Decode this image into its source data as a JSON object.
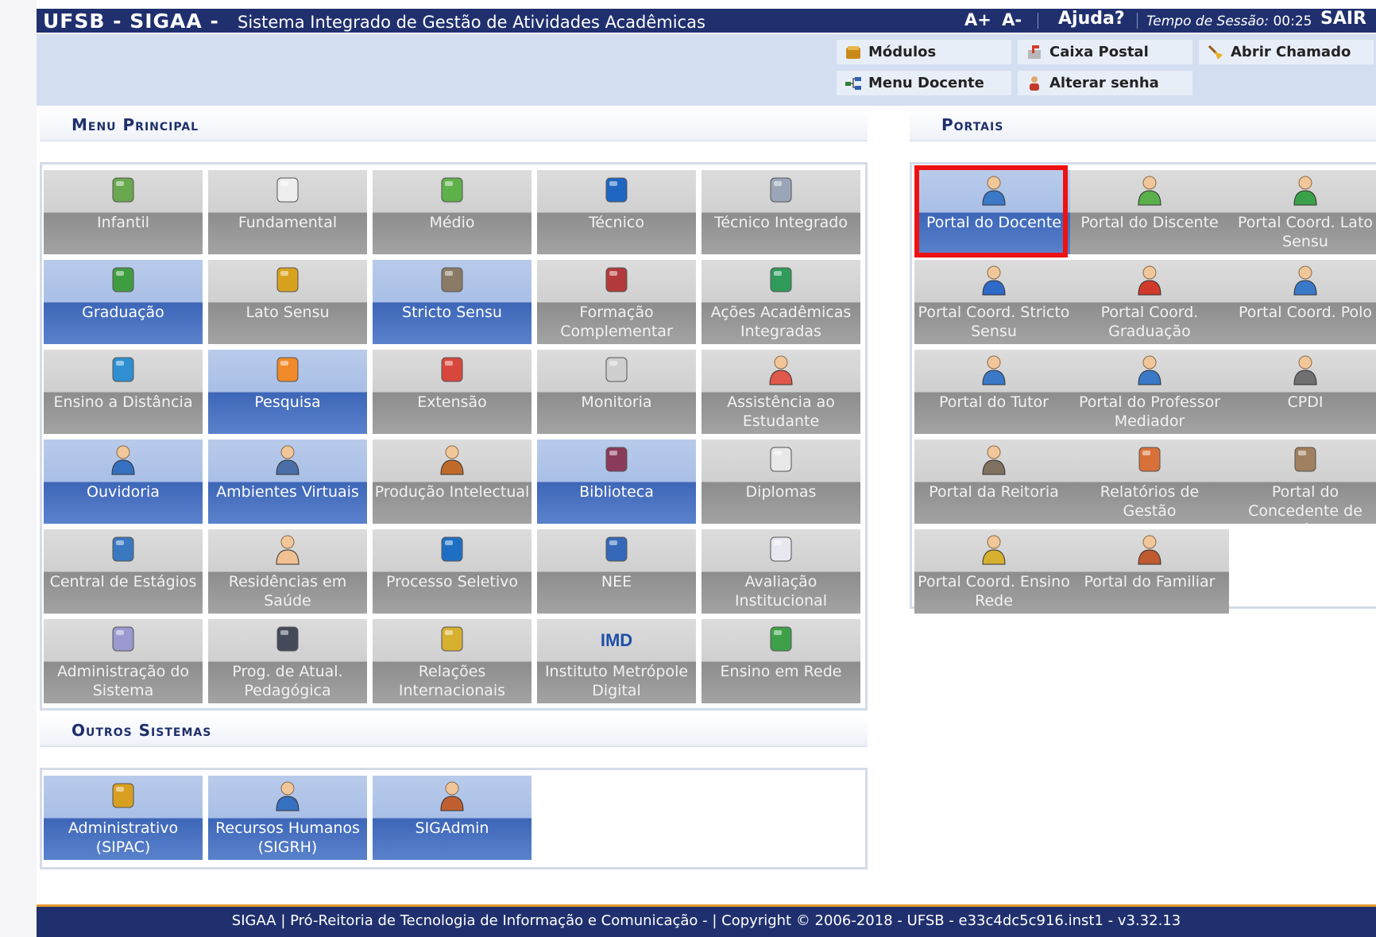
{
  "topbar": {
    "brand": "UFSB - SIGAA -",
    "system_name": "Sistema Integrado de Gestão de Atividades Acadêmicas",
    "font_increase": "A+",
    "font_decrease": "A-",
    "help": "Ajuda?",
    "session_label": "Tempo de Sessão:",
    "session_time": "00:25",
    "logout": "SAIR"
  },
  "quick_links": {
    "modules": "Módulos",
    "mailbox": "Caixa Postal",
    "open_ticket": "Abrir Chamado",
    "teacher_menu": "Menu Docente",
    "change_password": "Alterar senha"
  },
  "main_menu": {
    "title": "Menu Principal",
    "items": [
      {
        "label": "Infantil",
        "icon": "pencil-cup-icon",
        "active": false
      },
      {
        "label": "Fundamental",
        "icon": "notepad-icon",
        "active": false
      },
      {
        "label": "Médio",
        "icon": "pencil-icon",
        "active": false
      },
      {
        "label": "Técnico",
        "icon": "blue-book-icon",
        "active": false
      },
      {
        "label": "Técnico Integrado",
        "icon": "drafting-icon",
        "active": false
      },
      {
        "label": "Graduação",
        "icon": "books-stack-icon",
        "active": true
      },
      {
        "label": "Lato Sensu",
        "icon": "folder-icon",
        "active": false
      },
      {
        "label": "Stricto Sensu",
        "icon": "briefcase-icon",
        "active": true
      },
      {
        "label": "Formação Complementar",
        "icon": "red-book-icon",
        "active": false
      },
      {
        "label": "Ações Acadêmicas Integradas",
        "icon": "puzzle-icon",
        "active": false
      },
      {
        "label": "Ensino a Distância",
        "icon": "globe-icon",
        "active": false
      },
      {
        "label": "Pesquisa",
        "icon": "flask-icon",
        "active": true
      },
      {
        "label": "Extensão",
        "icon": "house-icon",
        "active": false
      },
      {
        "label": "Monitoria",
        "icon": "presentation-board-icon",
        "active": false
      },
      {
        "label": "Assistência ao Estudante",
        "icon": "student-support-icon",
        "active": false
      },
      {
        "label": "Ouvidoria",
        "icon": "headset-user-icon",
        "active": true
      },
      {
        "label": "Ambientes Virtuais",
        "icon": "user-group-icon",
        "active": true
      },
      {
        "label": "Produção Intelectual",
        "icon": "user-check-icon",
        "active": false
      },
      {
        "label": "Biblioteca",
        "icon": "open-book-icon",
        "active": true
      },
      {
        "label": "Diplomas",
        "icon": "certificate-icon",
        "active": false
      },
      {
        "label": "Central de Estágios",
        "icon": "address-book-icon",
        "active": false
      },
      {
        "label": "Residências em Saúde",
        "icon": "doctor-icon",
        "active": false
      },
      {
        "label": "Processo Seletivo",
        "icon": "spiral-icon",
        "active": false
      },
      {
        "label": "NEE",
        "icon": "accessibility-icon",
        "active": false
      },
      {
        "label": "Avaliação Institucional",
        "icon": "checklist-icon",
        "active": false
      },
      {
        "label": "Administração do Sistema",
        "icon": "gear-icon",
        "active": false
      },
      {
        "label": "Prog. de Atual. Pedagógica",
        "icon": "monitor-icon",
        "active": false
      },
      {
        "label": "Relações Internacionais",
        "icon": "world-map-icon",
        "active": false
      },
      {
        "label": "Instituto Metrópole Digital",
        "icon": "imd-logo-icon",
        "active": false
      },
      {
        "label": "Ensino em Rede",
        "icon": "network-map-icon",
        "active": false
      }
    ]
  },
  "other_systems": {
    "title": "Outros Sistemas",
    "items": [
      {
        "label": "Administrativo (SIPAC)",
        "icon": "admin-icon",
        "active": true
      },
      {
        "label": "Recursos Humanos (SIGRH)",
        "icon": "hr-person-icon",
        "active": true
      },
      {
        "label": "SIGAdmin",
        "icon": "admin-user-icon",
        "active": true
      }
    ]
  },
  "portals": {
    "title": "Portais",
    "items": [
      {
        "label": "Portal do Docente",
        "icon": "teacher-icon",
        "active": true
      },
      {
        "label": "Portal do Discente",
        "icon": "student-icon",
        "active": false
      },
      {
        "label": "Portal Coord. Lato Sensu",
        "icon": "coordinator-green-icon",
        "active": false
      },
      {
        "label": "Portal Coord. Stricto Sensu",
        "icon": "coordinator-blue-icon",
        "active": false
      },
      {
        "label": "Portal Coord. Graduação",
        "icon": "coordinator-red-icon",
        "active": false
      },
      {
        "label": "Portal Coord. Polo",
        "icon": "polo-coordinator-icon",
        "active": false
      },
      {
        "label": "Portal do Tutor",
        "icon": "tutor-icon",
        "active": false
      },
      {
        "label": "Portal do Professor Mediador",
        "icon": "mediator-icon",
        "active": false
      },
      {
        "label": "CPDI",
        "icon": "cpdi-user-icon",
        "active": false
      },
      {
        "label": "Portal da Reitoria",
        "icon": "rector-icon",
        "active": false
      },
      {
        "label": "Relatórios de Gestão",
        "icon": "reports-icon",
        "active": false
      },
      {
        "label": "Portal do Concedente de Estágio",
        "icon": "id-card-icon",
        "active": false
      },
      {
        "label": "Portal Coord. Ensino Rede",
        "icon": "network-coordinator-icon",
        "active": false
      },
      {
        "label": "Portal do Familiar",
        "icon": "family-icon",
        "active": false
      }
    ]
  },
  "footer": {
    "text": "SIGAA | Pró-Reitoria de Tecnologia de Informação e Comunicação - | Copyright © 2006-2018 - UFSB - e33c4dc5c916.inst1 - v3.32.13"
  },
  "colors": {
    "topbar_bg": "#20306e",
    "tile_active": "#3d66b8",
    "tile_inactive": "#8d8d8d",
    "highlight": "#ee1111",
    "footer_border": "#e89a2c"
  }
}
